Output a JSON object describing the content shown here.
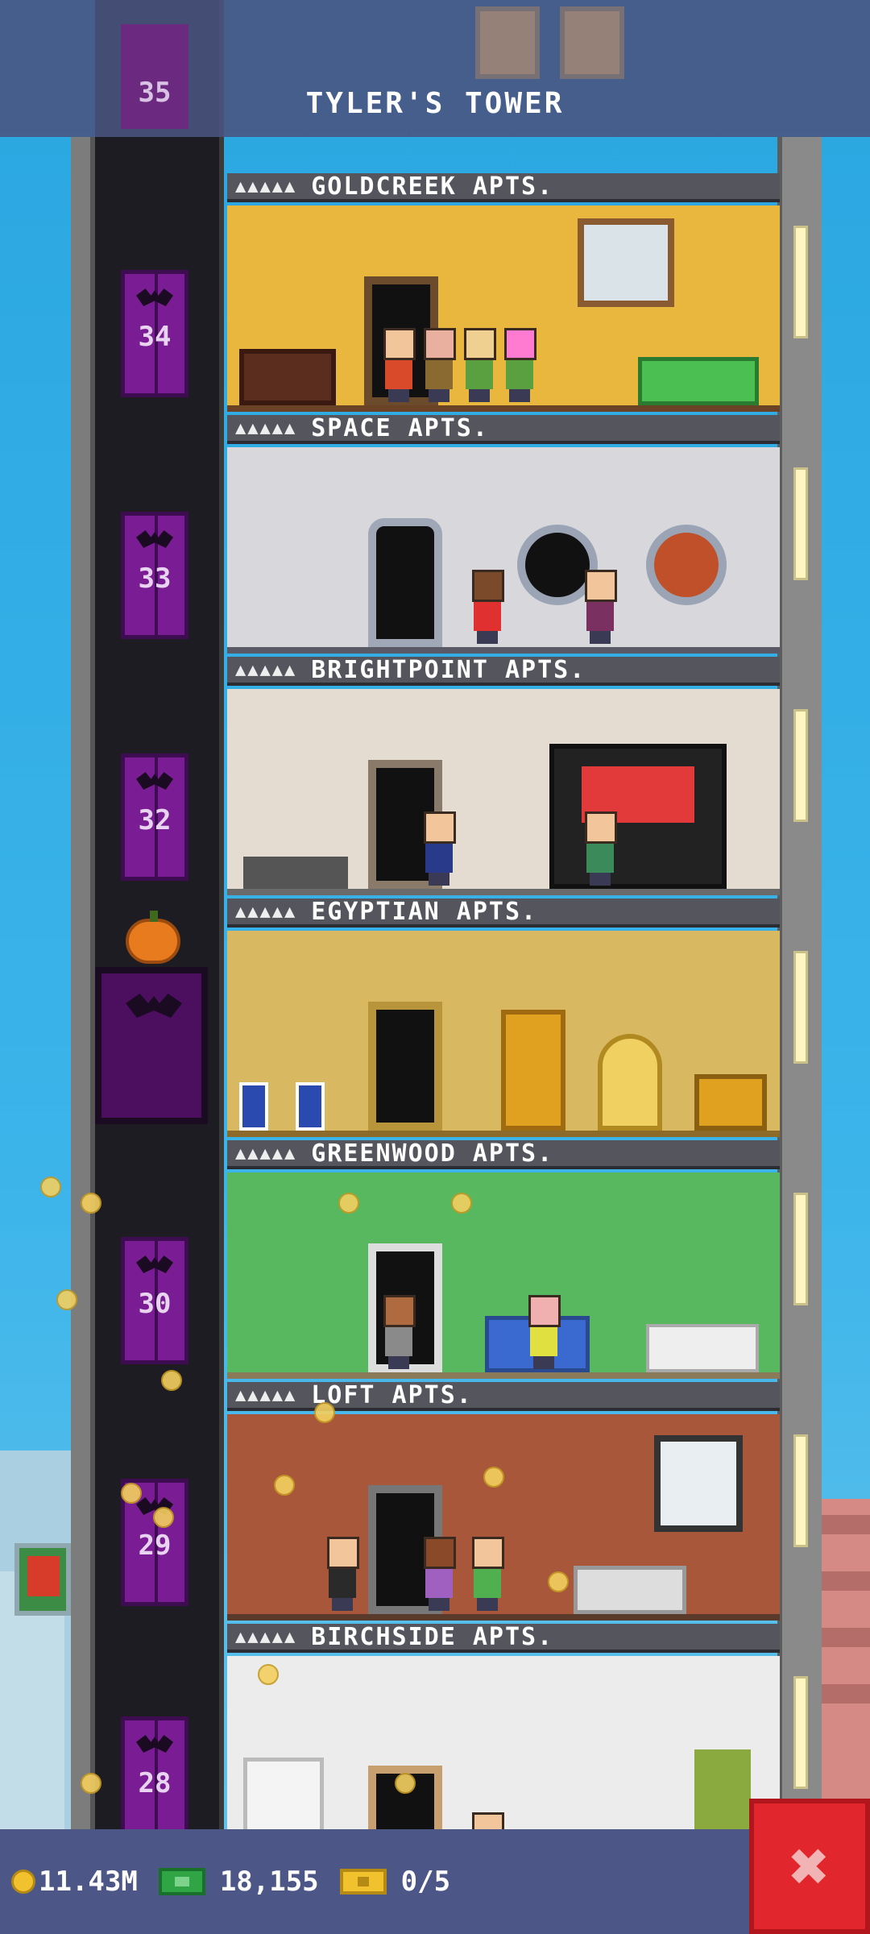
{
  "header": {
    "title": "TYLER'S TOWER",
    "top_floor_number": "35"
  },
  "floors": [
    {
      "number": "34",
      "stars": "▲▲▲▲▲",
      "name": "GOLDCREEK APTS.",
      "wall": "#e9b63e",
      "floorColor": "#6b4226"
    },
    {
      "number": "33",
      "stars": "▲▲▲▲▲",
      "name": "SPACE APTS.",
      "wall": "#d8d8dc",
      "floorColor": "#5a5a66"
    },
    {
      "number": "32",
      "stars": "▲▲▲▲▲",
      "name": "BRIGHTPOINT APTS.",
      "wall": "#e4dcd0",
      "floorColor": "#6a6a6a"
    },
    {
      "number": "",
      "stars": "▲▲▲▲▲",
      "name": "EGYPTIAN APTS.",
      "wall": "#d9b862",
      "floorColor": "#8c6a2a"
    },
    {
      "number": "30",
      "stars": "▲▲▲▲▲",
      "name": "GREENWOOD APTS.",
      "wall": "#58b860",
      "floorColor": "#8a7a5a"
    },
    {
      "number": "29",
      "stars": "▲▲▲▲▲",
      "name": "LOFT APTS.",
      "wall": "#a9573a",
      "floorColor": "#5a3a2a"
    },
    {
      "number": "28",
      "stars": "▲▲▲▲▲",
      "name": "BIRCHSIDE APTS.",
      "wall": "#ececec",
      "floorColor": "#b0b0b0"
    }
  ],
  "bottom_bar": {
    "coins": "11.43M",
    "bux": "18,155",
    "tickets": "0/5",
    "close_label": "✖"
  },
  "icons": {
    "coin": "coin-icon",
    "cash": "bux-icon",
    "ticket": "golden-ticket-icon",
    "close": "close-icon"
  }
}
